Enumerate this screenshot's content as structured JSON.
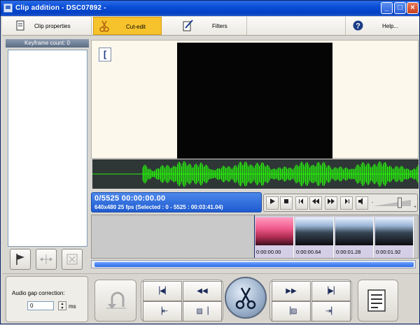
{
  "window": {
    "title": "Clip addition - DSC07892 -",
    "min": "_",
    "max": "□",
    "close": "×"
  },
  "toolbar": {
    "clip_properties": "Clip properties",
    "cut_edit": "Cut-edit",
    "filters": "Filters",
    "help": "Help..."
  },
  "keyframes": {
    "header": "Keyframe count: 0"
  },
  "preview": {
    "bracket": "["
  },
  "info": {
    "position": "0/5525  00:00:00.00",
    "details": "640x480 25  fps  (Selected : 0 - 5525 : 00:03:41.04)"
  },
  "volume": {
    "level": 0.75
  },
  "filmstrip": {
    "frames": [
      {
        "timecode": "0:00:00.00",
        "style": "red"
      },
      {
        "timecode": "0:00:00.64",
        "style": "normal"
      },
      {
        "timecode": "0:00:01.28",
        "style": "normal"
      },
      {
        "timecode": "0:00:01.92",
        "style": "normal"
      }
    ]
  },
  "audio_gap": {
    "label": "Audio gap correction:",
    "value": "0",
    "unit": "ms"
  },
  "colors": {
    "accent": "#f6c32c",
    "info_blue": "#2a66d8",
    "waveform": "#27f00c"
  }
}
